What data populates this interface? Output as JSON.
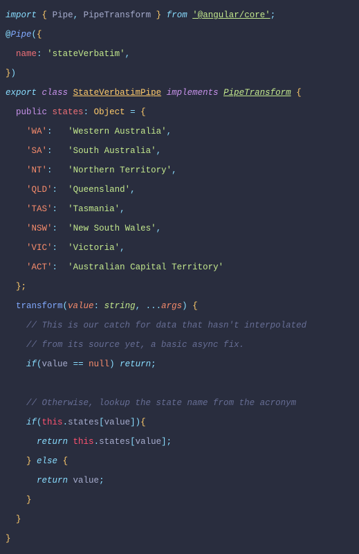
{
  "line1": {
    "import": "import",
    "brace_open": "{",
    "pipe": "Pipe",
    "comma": ",",
    "pipetransform": "PipeTransform",
    "brace_close": "}",
    "from": "from",
    "module": "'@angular/core'",
    "semi": ";"
  },
  "line2": {
    "at": "@",
    "pipe": "Pipe",
    "paren_open": "(",
    "brace_open": "{"
  },
  "line3": {
    "name": "name",
    "colon": ":",
    "value": "'stateVerbatim'",
    "comma": ","
  },
  "line4": {
    "brace_close": "}",
    "paren_close": ")"
  },
  "line5": {
    "export": "export",
    "class": "class",
    "classname": "StateVerbatimPipe",
    "implements": "implements",
    "interface": "PipeTransform",
    "brace": "{"
  },
  "line6": {
    "public": "public",
    "states": "states",
    "colon": ":",
    "object": "Object",
    "eq": "=",
    "brace": "{"
  },
  "states": {
    "wa_key": "'WA'",
    "wa_val": "'Western Australia'",
    "sa_key": "'SA'",
    "sa_val": "'South Australia'",
    "nt_key": "'NT'",
    "nt_val": "'Northern Territory'",
    "qld_key": "'QLD'",
    "qld_val": "'Queensland'",
    "tas_key": "'TAS'",
    "tas_val": "'Tasmania'",
    "nsw_key": "'NSW'",
    "nsw_val": "'New South Wales'",
    "vic_key": "'VIC'",
    "vic_val": "'Victoria'",
    "act_key": "'ACT'",
    "act_val": "'Australian Capital Territory'"
  },
  "line15": {
    "close": "};"
  },
  "line16": {
    "transform": "transform",
    "paren_open": "(",
    "value": "value",
    "colon": ":",
    "string": "string",
    "comma": ",",
    "spread": "...",
    "args": "args",
    "paren_close": ")",
    "brace": "{"
  },
  "comment1": "// This is our catch for data that hasn't interpolated",
  "comment2": "// from its source yet, a basic async fix.",
  "line19": {
    "if": "if",
    "paren_open": "(",
    "value": "value",
    "eqeq": "==",
    "null": "null",
    "paren_close": ")",
    "return": "return",
    "semi": ";"
  },
  "comment3": "// Otherwise, lookup the state name from the acronym",
  "line22": {
    "if": "if",
    "paren_open": "(",
    "this": "this",
    "dot": ".",
    "states": "states",
    "bracket_open": "[",
    "value": "value",
    "bracket_close": "]",
    "paren_close": ")",
    "brace": "{"
  },
  "line23": {
    "return": "return",
    "this": "this",
    "dot": ".",
    "states": "states",
    "bracket_open": "[",
    "value": "value",
    "bracket_close": "]",
    "semi": ";"
  },
  "line24": {
    "brace": "}",
    "else": "else",
    "brace2": "{"
  },
  "line25": {
    "return": "return",
    "value": "value",
    "semi": ";"
  },
  "closebrace": "}"
}
